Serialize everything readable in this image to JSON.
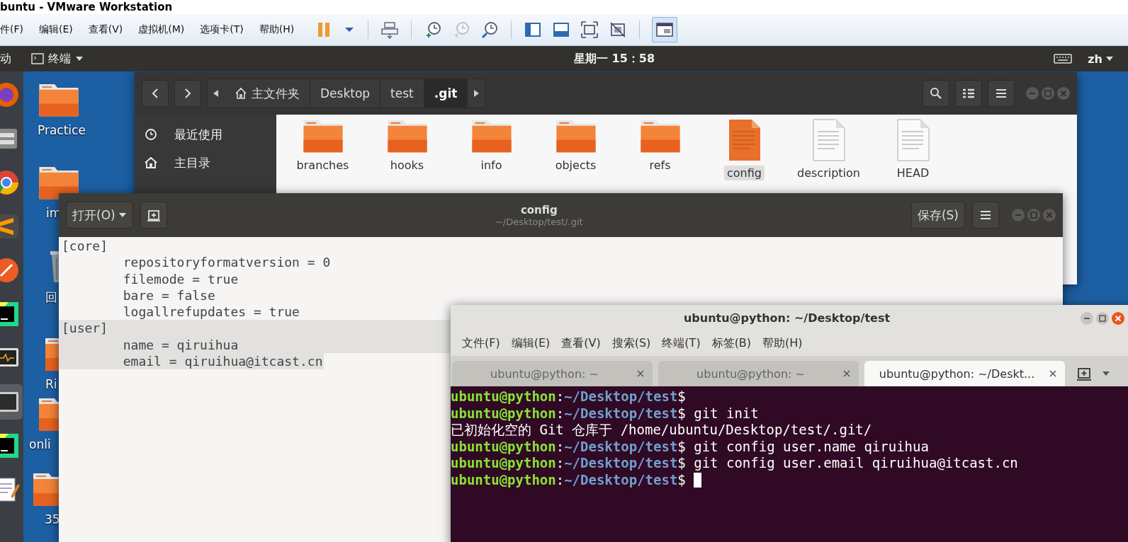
{
  "vmware": {
    "title": "buntu - VMware Workstation",
    "menu": [
      "件(F)",
      "编辑(E)",
      "查看(V)",
      "虚拟机(M)",
      "选项卡(T)",
      "帮助(H)"
    ],
    "toolbar": [
      {
        "kind": "pause",
        "disabled": false,
        "selected": false
      },
      {
        "kind": "dropdown",
        "disabled": false,
        "selected": false
      },
      {
        "kind": "separator"
      },
      {
        "kind": "send-keys",
        "disabled": false,
        "selected": false
      },
      {
        "kind": "separator"
      },
      {
        "kind": "snapshot",
        "disabled": false,
        "selected": false
      },
      {
        "kind": "revert",
        "disabled": true,
        "selected": false
      },
      {
        "kind": "manager",
        "disabled": false,
        "selected": false
      },
      {
        "kind": "separator"
      },
      {
        "kind": "library",
        "disabled": false,
        "selected": false
      },
      {
        "kind": "thumbnail",
        "disabled": false,
        "selected": false
      },
      {
        "kind": "fullscreen",
        "disabled": false,
        "selected": false
      },
      {
        "kind": "unity",
        "disabled": false,
        "selected": false
      },
      {
        "kind": "separator"
      },
      {
        "kind": "console",
        "disabled": false,
        "selected": true
      }
    ]
  },
  "topbar": {
    "activities": "动",
    "app": "终端",
    "clock": "星期一 15：58",
    "input_method": "zh"
  },
  "dock": [
    {
      "kind": "firefox",
      "selected": false
    },
    {
      "kind": "files",
      "selected": false
    },
    {
      "kind": "chrome",
      "selected": false
    },
    {
      "kind": "sublime",
      "selected": false
    },
    {
      "kind": "postman",
      "selected": false
    },
    {
      "kind": "pycharm",
      "selected": false
    },
    {
      "kind": "monitor",
      "selected": false
    },
    {
      "kind": "terminal",
      "selected": true
    },
    {
      "kind": "pycharm",
      "selected": false
    },
    {
      "kind": "editor",
      "selected": false
    }
  ],
  "desktop_icons": [
    {
      "kind": "folder",
      "label": "Practice"
    },
    {
      "kind": "folder",
      "label": "im"
    },
    {
      "kind": "trash",
      "label": "回"
    },
    {
      "kind": "folder",
      "label": "Ri"
    },
    {
      "kind": "folder",
      "label": "onli"
    },
    {
      "kind": "folder",
      "label": "35"
    }
  ],
  "file_manager": {
    "path": [
      {
        "label": "主文件夹",
        "home": true,
        "selected": false
      },
      {
        "label": "Desktop",
        "home": false,
        "selected": false
      },
      {
        "label": "test",
        "home": false,
        "selected": false
      },
      {
        "label": ".git",
        "home": false,
        "selected": true
      }
    ],
    "sidebar": [
      {
        "kind": "recent",
        "label": "最近使用"
      },
      {
        "kind": "home",
        "label": "主目录"
      }
    ],
    "files": [
      {
        "kind": "folder",
        "name": "branches",
        "selected": false
      },
      {
        "kind": "folder",
        "name": "hooks",
        "selected": false
      },
      {
        "kind": "folder",
        "name": "info",
        "selected": false
      },
      {
        "kind": "folder",
        "name": "objects",
        "selected": false
      },
      {
        "kind": "folder",
        "name": "refs",
        "selected": false
      },
      {
        "kind": "config",
        "name": "config",
        "selected": true
      },
      {
        "kind": "text",
        "name": "description",
        "selected": false
      },
      {
        "kind": "text",
        "name": "HEAD",
        "selected": false
      }
    ]
  },
  "editor": {
    "open_button": "打开(O)",
    "title": "config",
    "subtitle": "~/Desktop/test/.git",
    "save_button": "保存(S)",
    "lines": [
      {
        "text": "[core]",
        "selected": false
      },
      {
        "text": "\trepositoryformatversion = 0",
        "selected": false
      },
      {
        "text": "\tfilemode = true",
        "selected": false
      },
      {
        "text": "\tbare = false",
        "selected": false
      },
      {
        "text": "\tlogallrefupdates = true",
        "selected": false
      },
      {
        "text": "[user]",
        "selected": true
      },
      {
        "text": "\tname = qiruihua",
        "selected": true
      },
      {
        "text": "\temail = qiruihua@itcast.cn",
        "selected": true
      }
    ]
  },
  "terminal": {
    "title": "ubuntu@python: ~/Desktop/test",
    "menu": [
      "文件(F)",
      "编辑(E)",
      "查看(V)",
      "搜索(S)",
      "终端(T)",
      "标签(B)",
      "帮助(H)"
    ],
    "tabs": [
      {
        "label": "ubuntu@python: ~",
        "selected": false
      },
      {
        "label": "ubuntu@python: ~",
        "selected": false
      },
      {
        "label": "ubuntu@python: ~/Deskt...",
        "selected": true
      }
    ],
    "lines": [
      {
        "kind": "prompt",
        "user": "ubuntu@python",
        "colon": ":",
        "path": "~/Desktop/test",
        "symbol": "$",
        "cursor": false
      },
      {
        "kind": "prompt",
        "user": "ubuntu@python",
        "colon": ":",
        "path": "~/Desktop/test",
        "symbol": "$",
        "command": " git init",
        "cursor": false
      },
      {
        "kind": "output",
        "text": "已初始化空的 Git 仓库于 /home/ubuntu/Desktop/test/.git/"
      },
      {
        "kind": "prompt",
        "user": "ubuntu@python",
        "colon": ":",
        "path": "~/Desktop/test",
        "symbol": "$",
        "command": " git config user.name qiruihua",
        "cursor": false
      },
      {
        "kind": "prompt",
        "user": "ubuntu@python",
        "colon": ":",
        "path": "~/Desktop/test",
        "symbol": "$",
        "command": " git config user.email qiruihua@itcast.cn",
        "cursor": false
      },
      {
        "kind": "prompt",
        "user": "ubuntu@python",
        "colon": ":",
        "path": "~/Desktop/test",
        "symbol": "$",
        "cursor": true
      }
    ]
  }
}
